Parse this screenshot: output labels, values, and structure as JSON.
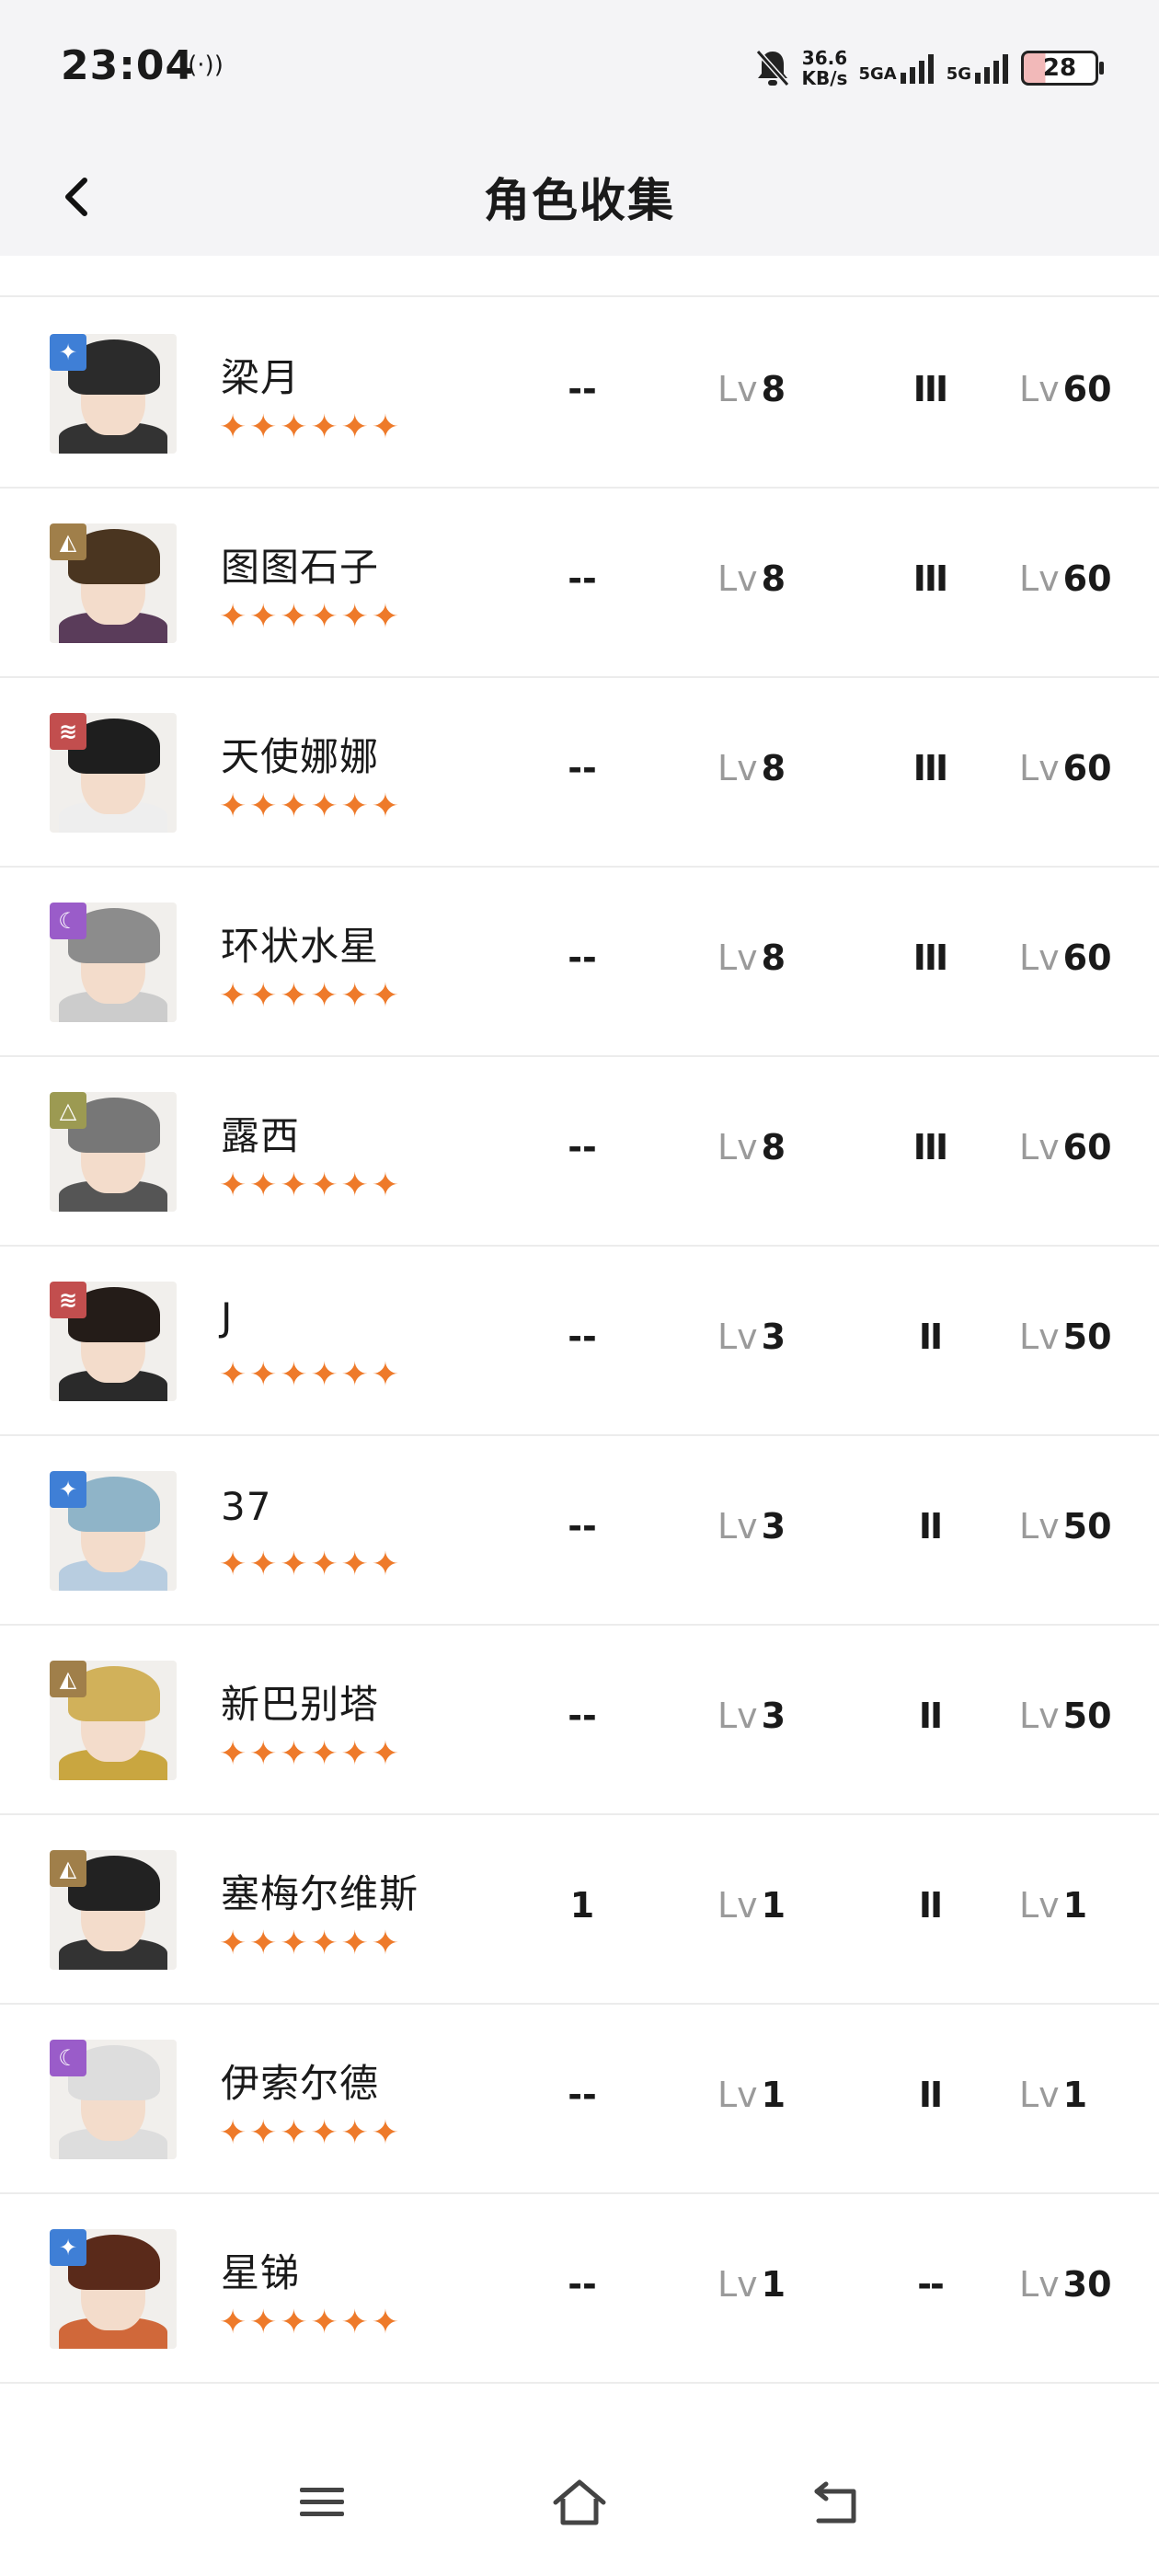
{
  "status_bar": {
    "time": "23:04",
    "hotspot_icon": "hotspot-icon",
    "speed_value": "36.6",
    "speed_unit": "KB/s",
    "net1": "5GA",
    "net2": "5G",
    "battery": "28",
    "battery_color": "#f2b9b9"
  },
  "header": {
    "title": "角色收集",
    "back_icon": "chevron-left-icon"
  },
  "colors": {
    "star": "#ee7a2a",
    "badge_blue": "#3f7fd6",
    "badge_gold": "#a07f4a",
    "badge_red": "#c24e4e",
    "badge_purple": "#9a5cc9",
    "badge_olive": "#9c9a52"
  },
  "characters": [
    {
      "name": "梁月",
      "stars": "✦✦✦✦✦✦",
      "col1": "--",
      "lv_label": "Lv",
      "level": "8",
      "tier": "III",
      "lv2_label": "Lv",
      "level2": "60",
      "badge": "star-icon",
      "badge_color": "#3f7fd6"
    },
    {
      "name": "图图石子",
      "stars": "✦✦✦✦✦✦",
      "col1": "--",
      "lv_label": "Lv",
      "level": "8",
      "tier": "III",
      "lv2_label": "Lv",
      "level2": "60",
      "badge": "beast-icon",
      "badge_color": "#a07f4a"
    },
    {
      "name": "天使娜娜",
      "stars": "✦✦✦✦✦✦",
      "col1": "--",
      "lv_label": "Lv",
      "level": "8",
      "tier": "III",
      "lv2_label": "Lv",
      "level2": "60",
      "badge": "wind-icon",
      "badge_color": "#c24e4e"
    },
    {
      "name": "环状水星",
      "stars": "✦✦✦✦✦✦",
      "col1": "--",
      "lv_label": "Lv",
      "level": "8",
      "tier": "III",
      "lv2_label": "Lv",
      "level2": "60",
      "badge": "moon-icon",
      "badge_color": "#9a5cc9"
    },
    {
      "name": "露西",
      "stars": "✦✦✦✦✦✦",
      "col1": "--",
      "lv_label": "Lv",
      "level": "8",
      "tier": "III",
      "lv2_label": "Lv",
      "level2": "60",
      "badge": "pyramid-icon",
      "badge_color": "#9c9a52"
    },
    {
      "name": "J",
      "stars": "✦✦✦✦✦✦",
      "col1": "--",
      "lv_label": "Lv",
      "level": "3",
      "tier": "II",
      "lv2_label": "Lv",
      "level2": "50",
      "badge": "wind-icon",
      "badge_color": "#c24e4e"
    },
    {
      "name": "37",
      "stars": "✦✦✦✦✦✦",
      "col1": "--",
      "lv_label": "Lv",
      "level": "3",
      "tier": "II",
      "lv2_label": "Lv",
      "level2": "50",
      "badge": "star-icon",
      "badge_color": "#3f7fd6"
    },
    {
      "name": "新巴别塔",
      "stars": "✦✦✦✦✦✦",
      "col1": "--",
      "lv_label": "Lv",
      "level": "3",
      "tier": "II",
      "lv2_label": "Lv",
      "level2": "50",
      "badge": "beast-icon",
      "badge_color": "#a07f4a"
    },
    {
      "name": "塞梅尔维斯",
      "stars": "✦✦✦✦✦✦",
      "col1": "1",
      "lv_label": "Lv",
      "level": "1",
      "tier": "II",
      "lv2_label": "Lv",
      "level2": "1",
      "badge": "beast-icon",
      "badge_color": "#a07f4a"
    },
    {
      "name": "伊索尔德",
      "stars": "✦✦✦✦✦✦",
      "col1": "--",
      "lv_label": "Lv",
      "level": "1",
      "tier": "II",
      "lv2_label": "Lv",
      "level2": "1",
      "badge": "moon-icon",
      "badge_color": "#9a5cc9"
    },
    {
      "name": "星锑",
      "stars": "✦✦✦✦✦✦",
      "col1": "--",
      "lv_label": "Lv",
      "level": "1",
      "tier": "--",
      "lv2_label": "Lv",
      "level2": "30",
      "badge": "star-icon",
      "badge_color": "#3f7fd6"
    }
  ],
  "nav": {
    "menu_icon": "menu-icon",
    "home_icon": "home-icon",
    "back_icon": "back-icon"
  }
}
